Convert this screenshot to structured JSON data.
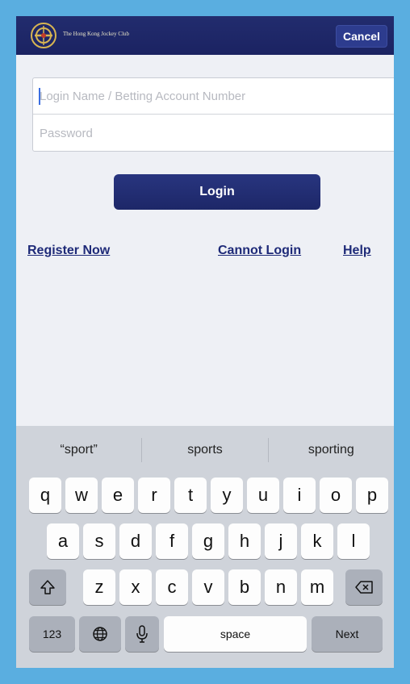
{
  "header": {
    "brand_text": "The Hong Kong Jockey Club",
    "cancel_label": "Cancel"
  },
  "form": {
    "username_placeholder": "Login Name / Betting Account Number",
    "password_placeholder": "Password",
    "login_label": "Login"
  },
  "links": {
    "register": "Register Now",
    "cannot_login": "Cannot Login",
    "help": "Help"
  },
  "keyboard": {
    "suggestions": [
      "“sport”",
      "sports",
      "sporting"
    ],
    "row1": [
      "q",
      "w",
      "e",
      "r",
      "t",
      "y",
      "u",
      "i",
      "o",
      "p"
    ],
    "row2": [
      "a",
      "s",
      "d",
      "f",
      "g",
      "h",
      "j",
      "k",
      "l"
    ],
    "row3": [
      "z",
      "x",
      "c",
      "v",
      "b",
      "n",
      "m"
    ],
    "numbers_label": "123",
    "space_label": "space",
    "next_label": "Next"
  },
  "colors": {
    "header": "#1b2362",
    "accent": "#1e2a78",
    "frame": "#5aaee0"
  }
}
